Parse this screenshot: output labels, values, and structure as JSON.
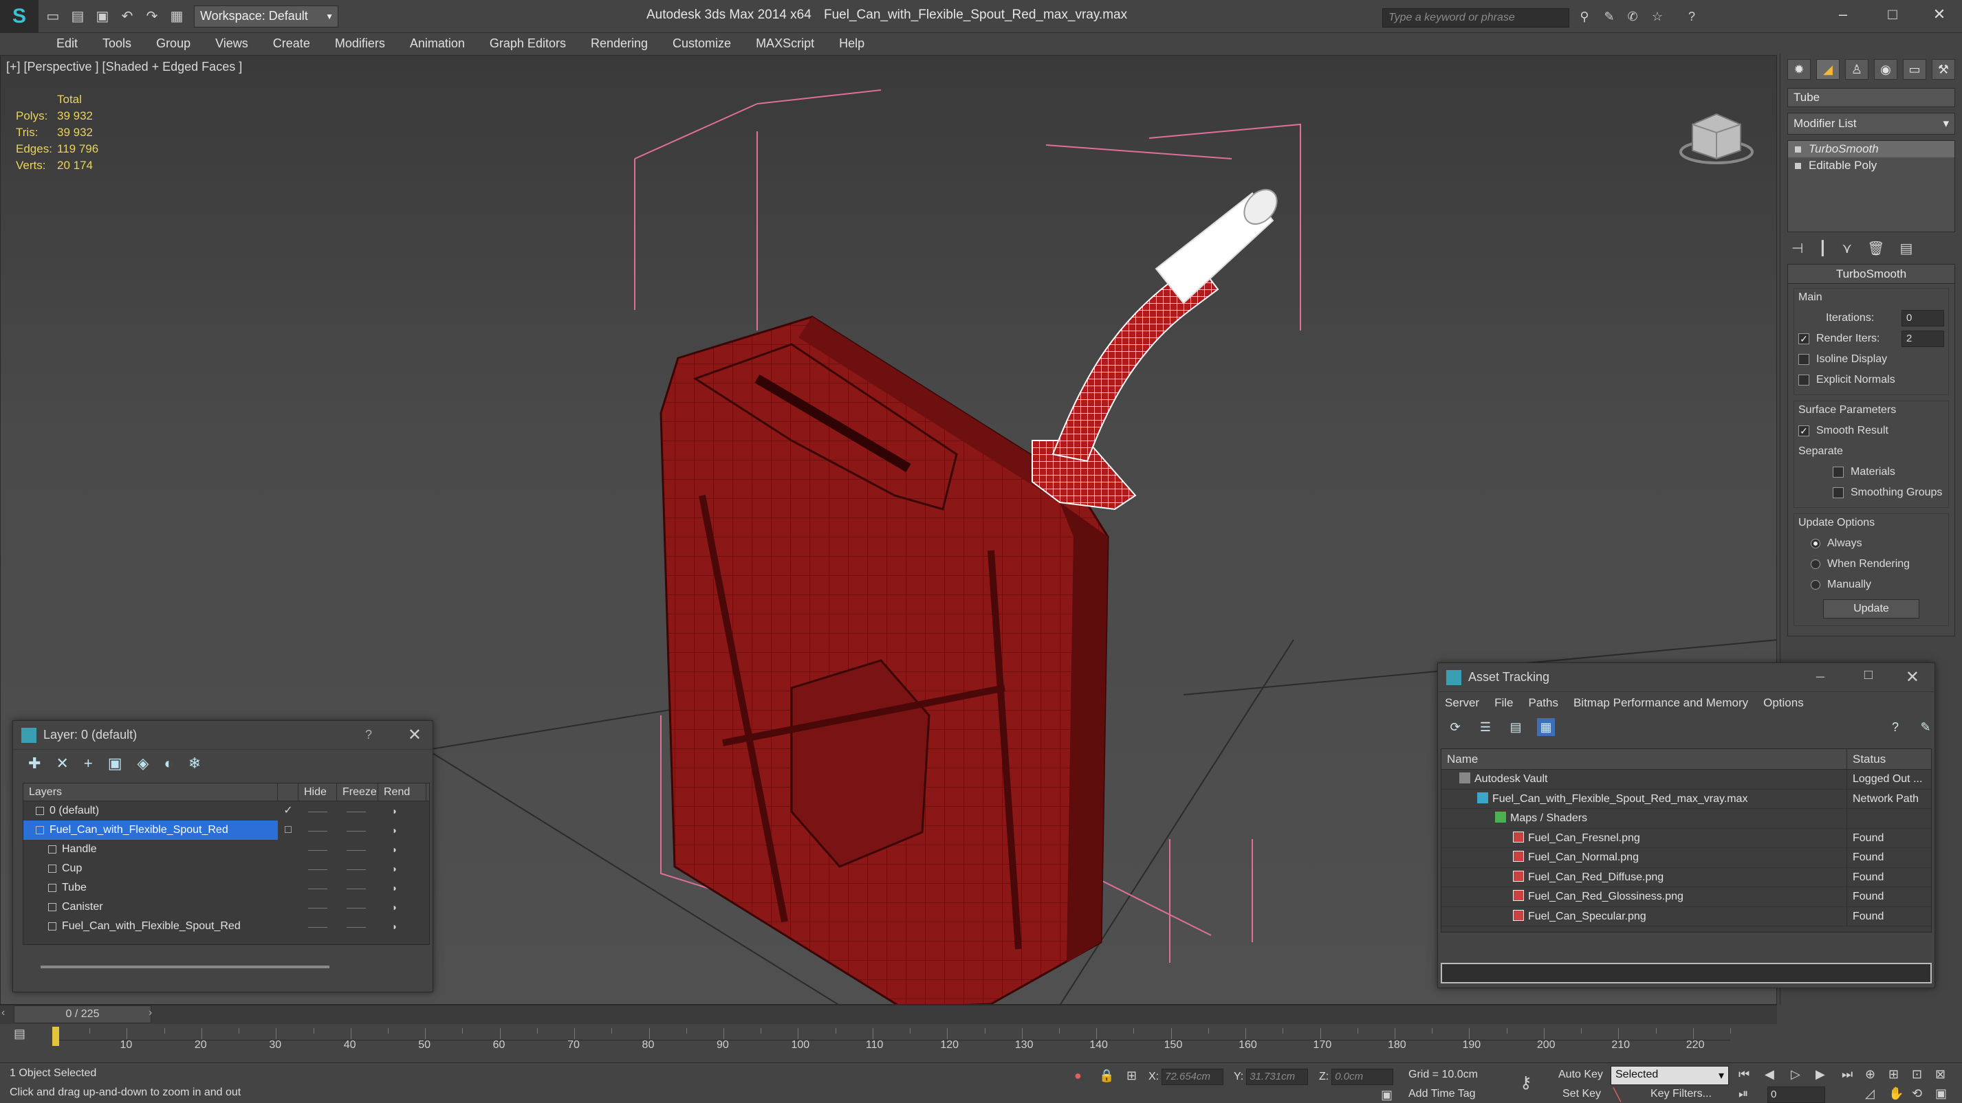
{
  "window": {
    "app_title": "Autodesk 3ds Max  2014 x64",
    "document_title": "Fuel_Can_with_Flexible_Spout_Red_max_vray.max",
    "workspace_label": "Workspace: Default",
    "search_placeholder": "Type a keyword or phrase"
  },
  "menu": [
    "Edit",
    "Tools",
    "Group",
    "Views",
    "Create",
    "Modifiers",
    "Animation",
    "Graph Editors",
    "Rendering",
    "Customize",
    "MAXScript",
    "Help"
  ],
  "viewport": {
    "label": "[+] [Perspective ] [Shaded + Edged Faces ]",
    "stats": {
      "header": "Total",
      "rows": [
        {
          "label": "Polys:",
          "value": "39 932"
        },
        {
          "label": "Tris:",
          "value": "39 932"
        },
        {
          "label": "Edges:",
          "value": "119 796"
        },
        {
          "label": "Verts:",
          "value": "20 174"
        }
      ]
    },
    "colors": {
      "can_red": "#8a1818",
      "wire_pink": "#e05a8a",
      "highlight_white": "#ffffff"
    }
  },
  "command_panel": {
    "object_name": "Tube",
    "modifier_list_label": "Modifier List",
    "stack": [
      {
        "label": "TurboSmooth",
        "selected": true
      },
      {
        "label": "Editable Poly",
        "selected": false
      }
    ],
    "turbosmooth": {
      "title": "TurboSmooth",
      "main_group": "Main",
      "iterations_label": "Iterations:",
      "iterations_value": "0",
      "render_iters_label": "Render Iters:",
      "render_iters_value": "2",
      "isoline_display": "Isoline Display",
      "explicit_normals": "Explicit Normals",
      "surface_group": "Surface Parameters",
      "smooth_result": "Smooth Result",
      "separate_label": "Separate",
      "materials": "Materials",
      "smoothing_groups": "Smoothing Groups",
      "update_group": "Update Options",
      "always": "Always",
      "when_rendering": "When Rendering",
      "manually": "Manually",
      "update_button": "Update"
    }
  },
  "layer_dialog": {
    "title": "Layer: 0 (default)",
    "help": "?",
    "columns": {
      "layers": "Layers",
      "hide": "Hide",
      "freeze": "Freeze",
      "render": "Rend"
    },
    "rows": [
      {
        "name": "0 (default)",
        "indent": 1,
        "selected": false,
        "current": true
      },
      {
        "name": "Fuel_Can_with_Flexible_Spout_Red",
        "indent": 1,
        "selected": true,
        "current": false
      },
      {
        "name": "Handle",
        "indent": 2,
        "selected": false,
        "current": false
      },
      {
        "name": "Cup",
        "indent": 2,
        "selected": false,
        "current": false
      },
      {
        "name": "Tube",
        "indent": 2,
        "selected": false,
        "current": false
      },
      {
        "name": "Canister",
        "indent": 2,
        "selected": false,
        "current": false
      },
      {
        "name": "Fuel_Can_with_Flexible_Spout_Red",
        "indent": 2,
        "selected": false,
        "current": false
      }
    ]
  },
  "asset_tracking": {
    "title": "Asset Tracking",
    "menu": [
      "Server",
      "File",
      "Paths",
      "Bitmap Performance and Memory",
      "Options"
    ],
    "columns": {
      "name": "Name",
      "status": "Status"
    },
    "rows": [
      {
        "name": "Autodesk Vault",
        "status": "Logged Out ...",
        "indent": 1,
        "icon": "vault"
      },
      {
        "name": "Fuel_Can_with_Flexible_Spout_Red_max_vray.max",
        "status": "Network Path",
        "indent": 2,
        "icon": "max"
      },
      {
        "name": "Maps / Shaders",
        "status": "",
        "indent": 3,
        "icon": "folder"
      },
      {
        "name": "Fuel_Can_Fresnel.png",
        "status": "Found",
        "indent": 4,
        "icon": "png"
      },
      {
        "name": "Fuel_Can_Normal.png",
        "status": "Found",
        "indent": 4,
        "icon": "png"
      },
      {
        "name": "Fuel_Can_Red_Diffuse.png",
        "status": "Found",
        "indent": 4,
        "icon": "png"
      },
      {
        "name": "Fuel_Can_Red_Glossiness.png",
        "status": "Found",
        "indent": 4,
        "icon": "png"
      },
      {
        "name": "Fuel_Can_Specular.png",
        "status": "Found",
        "indent": 4,
        "icon": "png"
      }
    ]
  },
  "timeline": {
    "frame_counter": "0 / 225",
    "ticks": [
      "10",
      "20",
      "30",
      "40",
      "50",
      "60",
      "70",
      "80",
      "90",
      "100",
      "110",
      "120",
      "130",
      "140",
      "150",
      "160",
      "170",
      "180",
      "190",
      "200",
      "210",
      "220"
    ]
  },
  "status": {
    "selection": "1 Object Selected",
    "prompt": "Click and drag up-and-down to zoom in and out",
    "x_label": "X:",
    "x_value": "72.654cm",
    "y_label": "Y:",
    "y_value": "31.731cm",
    "z_label": "Z:",
    "z_value": "0.0cm",
    "grid": "Grid = 10.0cm",
    "auto_key": "Auto Key",
    "set_key": "Set Key",
    "selected_dropdown": "Selected",
    "key_filters": "Key Filters...",
    "add_time_tag": "Add Time Tag",
    "frame_field": "0"
  }
}
